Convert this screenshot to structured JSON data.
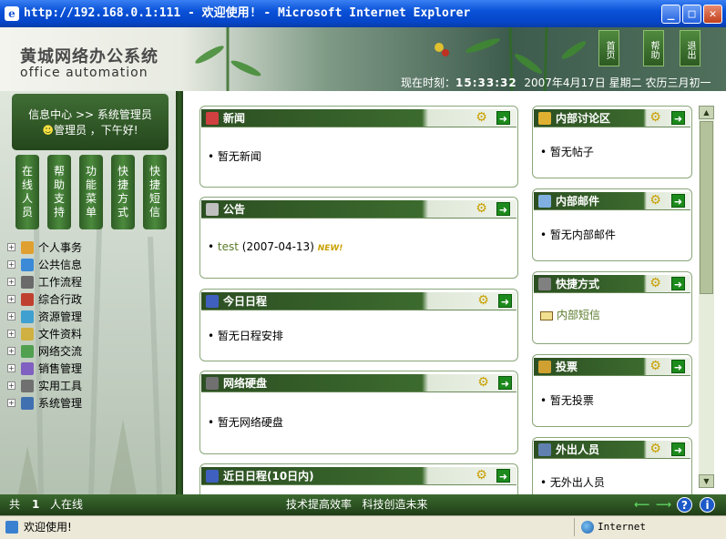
{
  "window": {
    "title": "http://192.168.0.1:111 - 欢迎使用! - Microsoft Internet Explorer",
    "min": "_",
    "max": "□",
    "close": "✕"
  },
  "banner": {
    "logo_cn": "黄城网络办公系统",
    "logo_en": "office automation",
    "btn_home": "首页",
    "btn_help": "帮助",
    "btn_exit": "退出",
    "time_label": "现在时刻：",
    "time": "15:33:32",
    "date": "2007年4月17日",
    "weekday": "星期二",
    "lunar": "农历三月初一"
  },
  "sidebar": {
    "info_line1": "信息中心 >> 系统管理员",
    "info_line2": "管理员 ，下午好!",
    "tabs": [
      "在线人员",
      "帮助支持",
      "功能菜单",
      "快捷方式",
      "快捷短信"
    ],
    "menu": [
      "个人事务",
      "公共信息",
      "工作流程",
      "综合行政",
      "资源管理",
      "文件资料",
      "网络交流",
      "销售管理",
      "实用工具",
      "系统管理"
    ]
  },
  "panels": {
    "news": {
      "title": "新闻",
      "body": "• 暂无新闻"
    },
    "notice": {
      "title": "公告",
      "item": "test",
      "date": " (2007-04-13)",
      "badge": "NEW!"
    },
    "schedule": {
      "title": "今日日程",
      "body": "• 暂无日程安排"
    },
    "disk": {
      "title": "网络硬盘",
      "body": "• 暂无网络硬盘"
    },
    "recent": {
      "title": "近日日程(10日内)"
    },
    "forum": {
      "title": "内部讨论区",
      "body": "• 暂无帖子"
    },
    "mail": {
      "title": "内部邮件",
      "body": "• 暂无内部邮件"
    },
    "shortcut": {
      "title": "快捷方式",
      "body": "内部短信"
    },
    "vote": {
      "title": "投票",
      "body": "• 暂无投票"
    },
    "out": {
      "title": "外出人员",
      "body": "• 无外出人员"
    }
  },
  "statusbar": {
    "online_prefix": "共",
    "online_count": "1",
    "online_suffix": "人在线",
    "slogan": "技术提高效率   科技创造未来"
  },
  "ie_status": {
    "text": "欢迎使用!",
    "zone": "Internet"
  },
  "colors": {
    "accent": "#2f5c25",
    "title_blue": "#0a52d8"
  }
}
